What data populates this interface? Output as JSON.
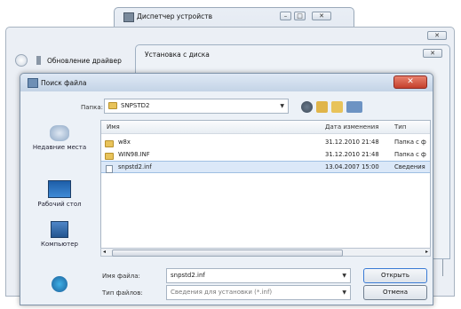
{
  "device_manager": {
    "title": "Диспетчер устройств"
  },
  "update_driver": {
    "title": "Обновление драйвер"
  },
  "install_disk": {
    "title": "Установка с диска"
  },
  "find_file": {
    "title": "Поиск файла",
    "folder_label": "Папка:",
    "folder_value": "SNPSTD2",
    "places": [
      {
        "label": "Недавние места",
        "icon": "recent-places-icon"
      },
      {
        "label": "Рабочий стол",
        "icon": "desktop-icon"
      },
      {
        "label": "Компьютер",
        "icon": "computer-icon"
      },
      {
        "label": "",
        "icon": "network-icon"
      }
    ],
    "columns": {
      "name": "Имя",
      "date": "Дата изменения",
      "type": "Тип"
    },
    "files": [
      {
        "name": "w8x",
        "date": "31.12.2010 21:48",
        "type": "Папка с ф",
        "kind": "folder"
      },
      {
        "name": "WIN98.INF",
        "date": "31.12.2010 21:48",
        "type": "Папка с ф",
        "kind": "folder"
      },
      {
        "name": "snpstd2.inf",
        "date": "13.04.2007 15:00",
        "type": "Сведения",
        "kind": "file"
      }
    ],
    "filename_label": "Имя файла:",
    "filename_value": "snpstd2.inf",
    "filetype_label": "Тип файлов:",
    "filetype_value": "Сведения для установки (*.inf)",
    "open_button": "Открыть",
    "cancel_button": "Отмена"
  },
  "colors": {
    "accent": "#3a6ea5",
    "close": "#c4402d",
    "selection": "#dbe8f8"
  }
}
